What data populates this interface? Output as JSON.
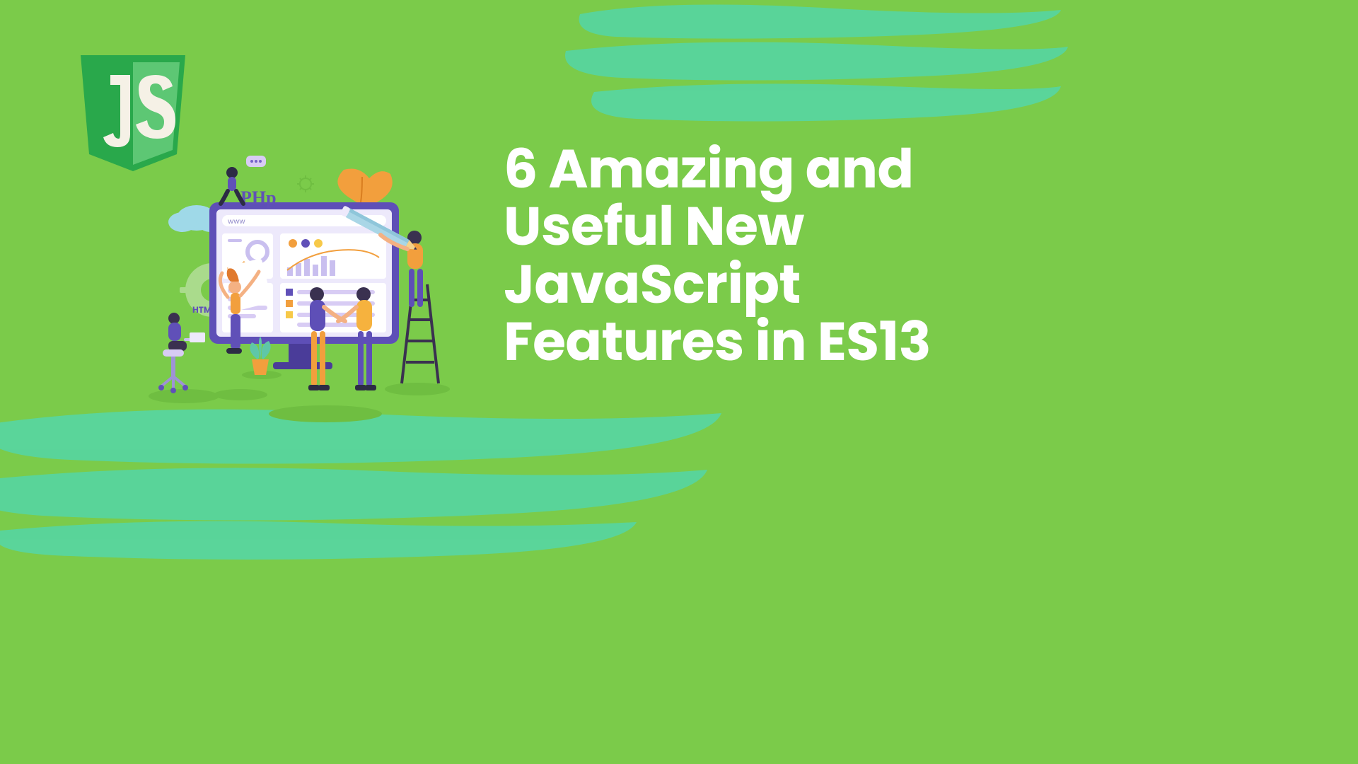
{
  "title": "6 Amazing and Useful New JavaScript Features in ES13",
  "logo_text": "JS",
  "illustration": {
    "php_label": "PHp",
    "html_label": "HTML",
    "www_label": "www"
  },
  "colors": {
    "bg": "#7BCB4A",
    "brush": "#55D6A5",
    "shield_dark": "#29A84B",
    "shield_light": "#5DC774",
    "monitor_frame": "#5E4FB7",
    "monitor_panel": "#EDE9FB",
    "accent_orange": "#F29F3D",
    "accent_yellow": "#F7C948",
    "accent_purple": "#7663C9"
  }
}
